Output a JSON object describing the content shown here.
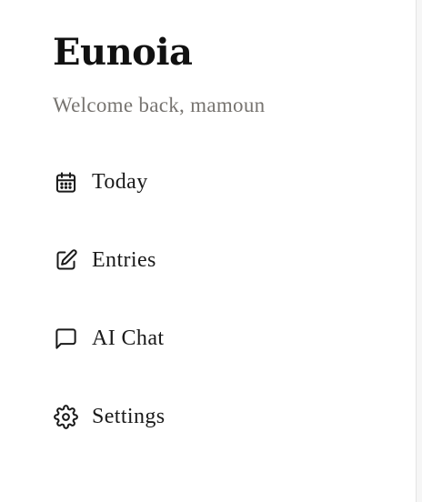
{
  "sidebar": {
    "app_title": "Eunoia",
    "welcome": "Welcome back, mamoun",
    "nav": [
      {
        "label": "Today",
        "icon": "calendar-icon"
      },
      {
        "label": "Entries",
        "icon": "edit-icon"
      },
      {
        "label": "AI Chat",
        "icon": "message-square-icon"
      },
      {
        "label": "Settings",
        "icon": "gear-icon"
      }
    ]
  }
}
